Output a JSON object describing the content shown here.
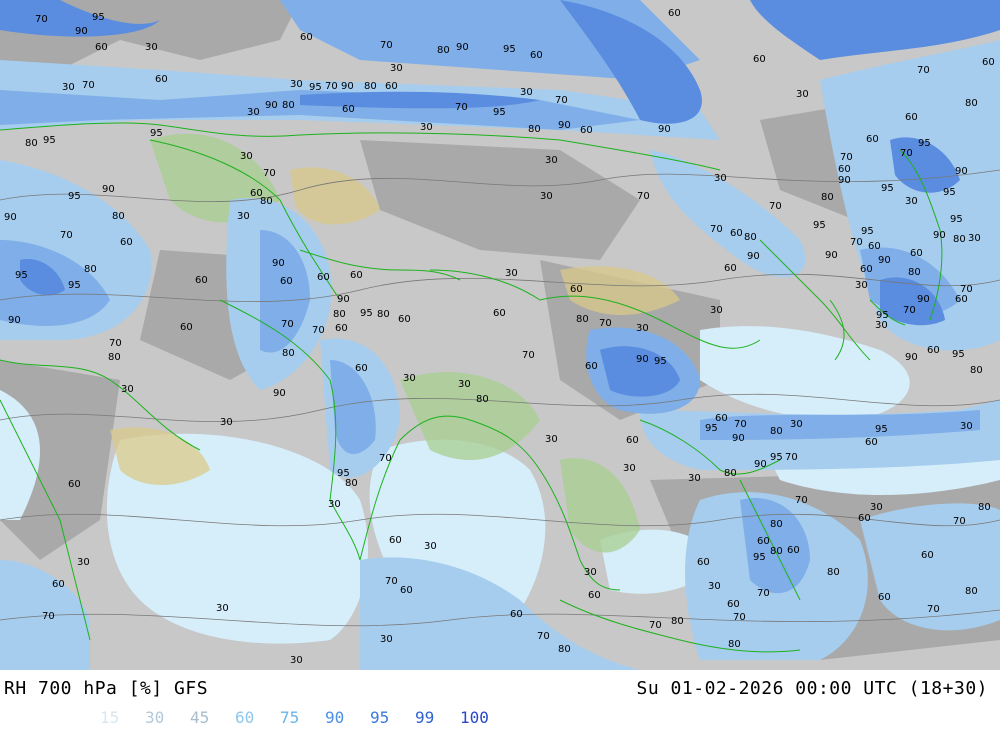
{
  "map": {
    "title": "RH 700 hPa [%] GFS",
    "datetime": "Su 01-02-2026 00:00 UTC (18+30)",
    "legend": [
      {
        "label": "15",
        "color": "#d8e6ee"
      },
      {
        "label": "30",
        "color": "#b4c8d8"
      },
      {
        "label": "45",
        "color": "#a8bccc"
      },
      {
        "label": "60",
        "color": "#8ec8f0"
      },
      {
        "label": "75",
        "color": "#6ab4ec"
      },
      {
        "label": "90",
        "color": "#4a90e4"
      },
      {
        "label": "95",
        "color": "#3c78dc"
      },
      {
        "label": "99",
        "color": "#2f62d0"
      },
      {
        "label": "100",
        "color": "#2848c8"
      }
    ],
    "contour_labels": [
      "30",
      "60",
      "70",
      "80",
      "90",
      "95"
    ],
    "colors": {
      "dry": "#d6eefa",
      "gray_light": "#c8c8c8",
      "gray_mid": "#a9a9a9",
      "blue_light": "#a6cdee",
      "blue_mid": "#7faee8",
      "blue_deep": "#5a8ce0",
      "borders": "#1db21d",
      "land_green": "#a7cf8f",
      "land_tan": "#d9c98a"
    }
  }
}
